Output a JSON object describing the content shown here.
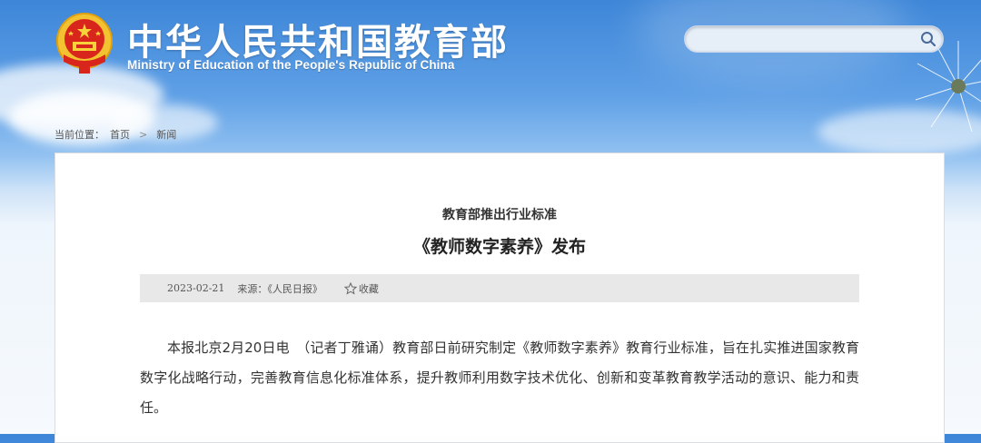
{
  "header": {
    "site_title_cn": "中华人民共和国教育部",
    "site_title_en": "Ministry of Education of the People's Republic of China"
  },
  "search": {
    "placeholder": "",
    "value": ""
  },
  "breadcrumb": {
    "label": "当前位置：",
    "home": "首页",
    "separator": ">",
    "current": "新闻"
  },
  "article": {
    "subtitle": "教育部推出行业标准",
    "title": "《教师数字素养》发布",
    "date": "2023-02-21",
    "source": "来源：《人民日报》",
    "favorite_label": "收藏",
    "body": "本报北京2月20日电　（记者丁雅诵）教育部日前研究制定《教师数字素养》教育行业标准，旨在扎实推进国家教育数字化战略行动，完善教育信息化标准体系，提升教师利用数字技术优化、创新和变革教育教学活动的意识、能力和责任。"
  },
  "colors": {
    "sky_top": "#3d86d8",
    "header_text": "#ffffff",
    "meta_bar_bg": "#e8e8e8",
    "body_text": "#333333"
  },
  "icons": [
    "national-emblem-icon",
    "search-icon",
    "star-icon",
    "dandelion-icon"
  ]
}
